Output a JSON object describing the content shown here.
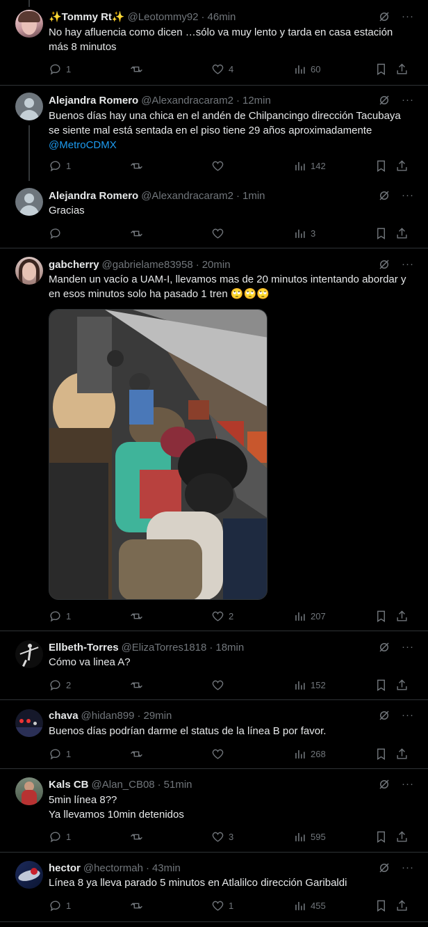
{
  "tweets": [
    {
      "name": "✨Tommy Rt✨",
      "handle": "@Leotommy92",
      "time": "46min",
      "text": "No hay afluencia como dicen …sólo va muy lento y tarda en casa estación más 8 minutos",
      "replies": "1",
      "reposts": "",
      "likes": "4",
      "views": "60"
    },
    {
      "name": "Alejandra Romero",
      "handle": "@Alexandracaram2",
      "time": "12min",
      "text": "Buenos días hay una chica en el andén de Chilpancingo dirección Tacubaya se siente mal está sentada en el piso tiene 29 años aproximadamente",
      "mention": "@MetroCDMX",
      "replies": "1",
      "reposts": "",
      "likes": "",
      "views": "142"
    },
    {
      "name": "Alejandra Romero",
      "handle": "@Alexandracaram2",
      "time": "1min",
      "text": "Gracias",
      "replies": "",
      "reposts": "",
      "likes": "",
      "views": "3"
    },
    {
      "name": "gabcherry",
      "handle": "@gabrielame83958",
      "time": "20min",
      "text": "Manden un vacío a UAM-I, llevamos mas de 20 minutos intentando abordar y en esos minutos solo ha pasado 1 tren 🙄🙄🙄",
      "replies": "1",
      "reposts": "",
      "likes": "2",
      "views": "207"
    },
    {
      "name": "Ellbeth-Torres",
      "handle": "@ElizaTorres1818",
      "time": "18min",
      "text": "Cómo va linea A?",
      "replies": "2",
      "reposts": "",
      "likes": "",
      "views": "152"
    },
    {
      "name": "chava",
      "handle": "@hidan899",
      "time": "29min",
      "text": "Buenos días podrían darme el status de la línea B por favor.",
      "replies": "1",
      "reposts": "",
      "likes": "",
      "views": "268"
    },
    {
      "name": "Kals CB",
      "handle": "@Alan_CB08",
      "time": "51min",
      "text": "5min línea 8??",
      "text2": "Ya llevamos 10min detenidos",
      "replies": "1",
      "reposts": "",
      "likes": "3",
      "views": "595"
    },
    {
      "name": "hector",
      "handle": "@hectormah",
      "time": "43min",
      "text": "Línea 8 ya lleva parado 5 minutos en Atlalilco dirección Garibaldi",
      "replies": "1",
      "reposts": "",
      "likes": "1",
      "views": "455"
    }
  ],
  "sep": "·",
  "more": "···",
  "colors": {
    "bg": "#000000",
    "text": "#e7e9ea",
    "muted": "#71767b",
    "link": "#1d9bf0",
    "border": "#2f3336"
  }
}
